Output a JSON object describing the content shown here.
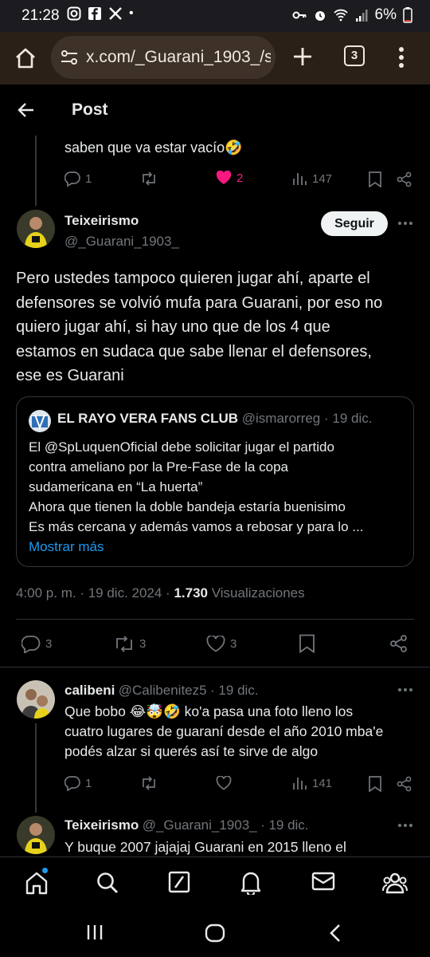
{
  "status_bar": {
    "time": "21:28",
    "battery": "6%",
    "dot": "•"
  },
  "browser": {
    "url": "x.com/_Guarani_1903_/s",
    "tab_count": "3"
  },
  "header": {
    "title": "Post"
  },
  "prev_reply": {
    "text_tail": "saben que va estar vacío🤣",
    "replies": "1",
    "retweets": "",
    "likes": "2",
    "views": "147"
  },
  "main_post": {
    "display_name": "Teixeirismo",
    "handle": "@_Guarani_1903_",
    "follow_label": "Seguir",
    "text_lines": [
      "Pero ustedes tampoco quieren jugar ahí, aparte el",
      "defensores se volvió mufa para Guarani, por eso no",
      "quiero jugar ahí, si hay uno que de los 4 que",
      "estamos en sudaca que sabe llenar el defensores,",
      "ese es Guarani"
    ],
    "quote": {
      "display_name": "EL RAYO VERA FANS CLUB",
      "handle": "@ismarorreg",
      "date": "· 19 dic.",
      "lines": [
        "El @SpLuquenOficial debe solicitar jugar  el partido",
        "contra ameliano por la Pre-Fase de la copa",
        "sudamericana en “La huerta”",
        "Ahora que tienen la doble bandeja estaría buenisimo",
        "Es más cercana y además vamos a rebosar y para lo ..."
      ],
      "show_more": "Mostrar más"
    },
    "timestamp": "4:00 p. m. · 19 dic. 2024 ·",
    "views_count": "1.730",
    "views_label": "Visualizaciones",
    "replies": "3",
    "retweets": "3",
    "likes": "3"
  },
  "reply1": {
    "display_name": "calibeni",
    "handle": "@Calibenitez5",
    "date": "· 19 dic.",
    "lines": [
      "Que bobo 😂🤯🤣 ko'a pasa una foto lleno los",
      "cuatro lugares de guaraní desde el año 2010 mba'e",
      "podés alzar si querés así te sirve de algo"
    ],
    "replies": "1",
    "views": "141"
  },
  "reply2": {
    "display_name": "Teixeirismo",
    "handle": "@_Guarani_1903_",
    "date": "· 19 dic.",
    "line": "Y buque 2007 jajajaj Guarani en 2015 lleno el"
  },
  "colors": {
    "accent": "#1d9bf0",
    "like_active": "#f91880",
    "muted": "#71767b",
    "browser_bar": "#2a2018"
  }
}
